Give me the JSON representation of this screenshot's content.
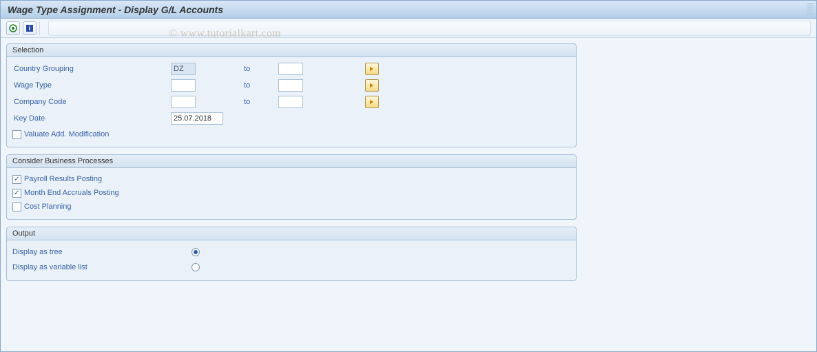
{
  "window": {
    "title": "Wage Type Assignment - Display G/L Accounts"
  },
  "toolbar": {
    "execute_icon": "execute-icon",
    "info_icon": "info-icon"
  },
  "watermark": "© www.tutorialkart.com",
  "groups": {
    "selection": {
      "title": "Selection",
      "country_label": "Country Grouping",
      "country_value": "DZ",
      "wage_label": "Wage Type",
      "wage_value": "",
      "company_label": "Company Code",
      "company_value": "",
      "to_label": "to",
      "keydate_label": "Key Date",
      "keydate_value": "25.07.2018",
      "valuate_label": "Valuate Add. Modification",
      "valuate_checked": false
    },
    "processes": {
      "title": "Consider Business Processes",
      "items": [
        {
          "label": "Payroll Results Posting",
          "checked": true
        },
        {
          "label": "Month End Accruals Posting",
          "checked": true
        },
        {
          "label": "Cost Planning",
          "checked": false
        }
      ]
    },
    "output": {
      "title": "Output",
      "tree_label": "Display as tree",
      "list_label": "Display as variable list",
      "selected": "tree"
    }
  }
}
